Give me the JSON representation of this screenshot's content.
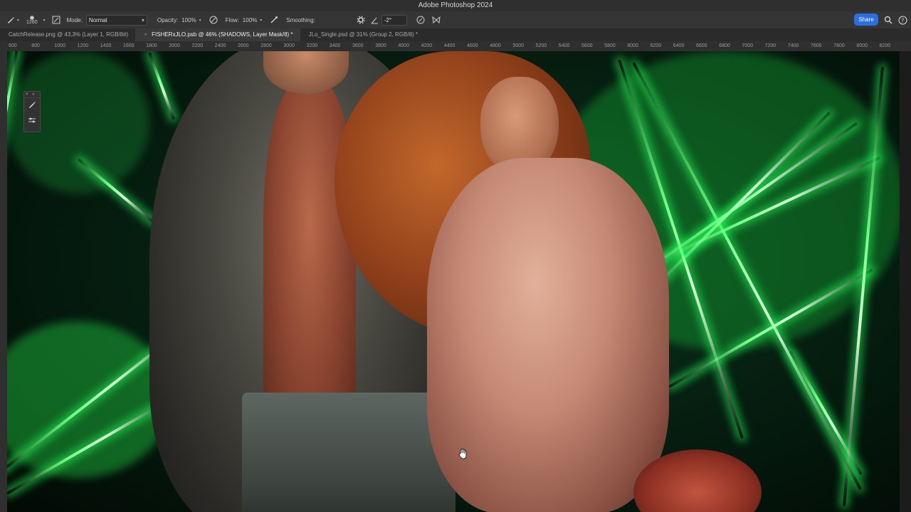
{
  "app": {
    "title": "Adobe Photoshop 2024"
  },
  "options_bar": {
    "brush_size": "1260",
    "mode_label": "Mode:",
    "mode_value": "Normal",
    "opacity_label": "Opacity:",
    "opacity_value": "100%",
    "flow_label": "Flow:",
    "flow_value": "100%",
    "smoothing_label": "Smoothing:",
    "smoothing_value": "",
    "angle_value": "-2°",
    "share_label": "Share"
  },
  "tabs": [
    {
      "label": "CatchRelease.png @ 43,3% (Layer 1, RGB/8#)",
      "active": false
    },
    {
      "label": "FISHERxJLO.psb @ 46% (SHADOWS, Layer Mask/8) *",
      "active": true
    },
    {
      "label": "JLo_Single.psd @ 31% (Group 2, RGB/8) *",
      "active": false
    }
  ],
  "ruler": {
    "ticks": [
      "600",
      "800",
      "1000",
      "1200",
      "1400",
      "1600",
      "1800",
      "2000",
      "2200",
      "2400",
      "2600",
      "2800",
      "3000",
      "3200",
      "3400",
      "3600",
      "3800",
      "4000",
      "4200",
      "4400",
      "4600",
      "4800",
      "5000",
      "5200",
      "5400",
      "5600",
      "5800",
      "6000",
      "6200",
      "6400",
      "6600",
      "6800",
      "7000",
      "7200",
      "7400",
      "7600",
      "7800",
      "8000",
      "8200"
    ]
  },
  "colors": {
    "accent": "#2b6fe0",
    "laser": "#7dff8f",
    "background": "#1e1e1e"
  },
  "icons": {
    "brush_tool": "brush-icon",
    "toggle_brush_panel": "brush-settings-icon",
    "airbrush_opacity": "pressure-opacity-icon",
    "airbrush_flow": "airbrush-icon",
    "smoothing_options": "gear-icon",
    "angle": "angle-icon",
    "pressure_size": "pressure-size-icon",
    "symmetry": "butterfly-icon",
    "search": "search-icon",
    "help": "help-icon",
    "cursor": "hand-icon"
  }
}
